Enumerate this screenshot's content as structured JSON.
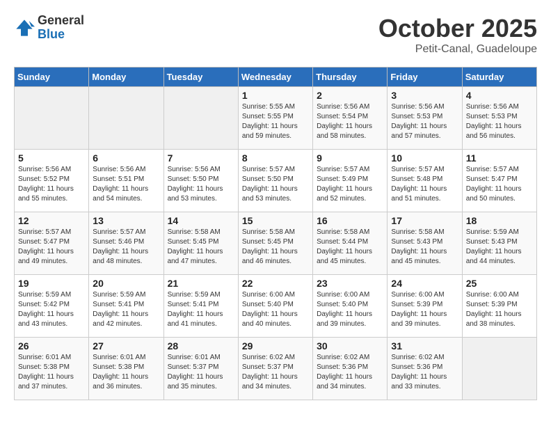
{
  "logo": {
    "general": "General",
    "blue": "Blue"
  },
  "header": {
    "month": "October 2025",
    "location": "Petit-Canal, Guadeloupe"
  },
  "weekdays": [
    "Sunday",
    "Monday",
    "Tuesday",
    "Wednesday",
    "Thursday",
    "Friday",
    "Saturday"
  ],
  "weeks": [
    [
      {
        "day": "",
        "info": ""
      },
      {
        "day": "",
        "info": ""
      },
      {
        "day": "",
        "info": ""
      },
      {
        "day": "1",
        "info": "Sunrise: 5:55 AM\nSunset: 5:55 PM\nDaylight: 11 hours\nand 59 minutes."
      },
      {
        "day": "2",
        "info": "Sunrise: 5:56 AM\nSunset: 5:54 PM\nDaylight: 11 hours\nand 58 minutes."
      },
      {
        "day": "3",
        "info": "Sunrise: 5:56 AM\nSunset: 5:53 PM\nDaylight: 11 hours\nand 57 minutes."
      },
      {
        "day": "4",
        "info": "Sunrise: 5:56 AM\nSunset: 5:53 PM\nDaylight: 11 hours\nand 56 minutes."
      }
    ],
    [
      {
        "day": "5",
        "info": "Sunrise: 5:56 AM\nSunset: 5:52 PM\nDaylight: 11 hours\nand 55 minutes."
      },
      {
        "day": "6",
        "info": "Sunrise: 5:56 AM\nSunset: 5:51 PM\nDaylight: 11 hours\nand 54 minutes."
      },
      {
        "day": "7",
        "info": "Sunrise: 5:56 AM\nSunset: 5:50 PM\nDaylight: 11 hours\nand 53 minutes."
      },
      {
        "day": "8",
        "info": "Sunrise: 5:57 AM\nSunset: 5:50 PM\nDaylight: 11 hours\nand 53 minutes."
      },
      {
        "day": "9",
        "info": "Sunrise: 5:57 AM\nSunset: 5:49 PM\nDaylight: 11 hours\nand 52 minutes."
      },
      {
        "day": "10",
        "info": "Sunrise: 5:57 AM\nSunset: 5:48 PM\nDaylight: 11 hours\nand 51 minutes."
      },
      {
        "day": "11",
        "info": "Sunrise: 5:57 AM\nSunset: 5:47 PM\nDaylight: 11 hours\nand 50 minutes."
      }
    ],
    [
      {
        "day": "12",
        "info": "Sunrise: 5:57 AM\nSunset: 5:47 PM\nDaylight: 11 hours\nand 49 minutes."
      },
      {
        "day": "13",
        "info": "Sunrise: 5:57 AM\nSunset: 5:46 PM\nDaylight: 11 hours\nand 48 minutes."
      },
      {
        "day": "14",
        "info": "Sunrise: 5:58 AM\nSunset: 5:45 PM\nDaylight: 11 hours\nand 47 minutes."
      },
      {
        "day": "15",
        "info": "Sunrise: 5:58 AM\nSunset: 5:45 PM\nDaylight: 11 hours\nand 46 minutes."
      },
      {
        "day": "16",
        "info": "Sunrise: 5:58 AM\nSunset: 5:44 PM\nDaylight: 11 hours\nand 45 minutes."
      },
      {
        "day": "17",
        "info": "Sunrise: 5:58 AM\nSunset: 5:43 PM\nDaylight: 11 hours\nand 45 minutes."
      },
      {
        "day": "18",
        "info": "Sunrise: 5:59 AM\nSunset: 5:43 PM\nDaylight: 11 hours\nand 44 minutes."
      }
    ],
    [
      {
        "day": "19",
        "info": "Sunrise: 5:59 AM\nSunset: 5:42 PM\nDaylight: 11 hours\nand 43 minutes."
      },
      {
        "day": "20",
        "info": "Sunrise: 5:59 AM\nSunset: 5:41 PM\nDaylight: 11 hours\nand 42 minutes."
      },
      {
        "day": "21",
        "info": "Sunrise: 5:59 AM\nSunset: 5:41 PM\nDaylight: 11 hours\nand 41 minutes."
      },
      {
        "day": "22",
        "info": "Sunrise: 6:00 AM\nSunset: 5:40 PM\nDaylight: 11 hours\nand 40 minutes."
      },
      {
        "day": "23",
        "info": "Sunrise: 6:00 AM\nSunset: 5:40 PM\nDaylight: 11 hours\nand 39 minutes."
      },
      {
        "day": "24",
        "info": "Sunrise: 6:00 AM\nSunset: 5:39 PM\nDaylight: 11 hours\nand 39 minutes."
      },
      {
        "day": "25",
        "info": "Sunrise: 6:00 AM\nSunset: 5:39 PM\nDaylight: 11 hours\nand 38 minutes."
      }
    ],
    [
      {
        "day": "26",
        "info": "Sunrise: 6:01 AM\nSunset: 5:38 PM\nDaylight: 11 hours\nand 37 minutes."
      },
      {
        "day": "27",
        "info": "Sunrise: 6:01 AM\nSunset: 5:38 PM\nDaylight: 11 hours\nand 36 minutes."
      },
      {
        "day": "28",
        "info": "Sunrise: 6:01 AM\nSunset: 5:37 PM\nDaylight: 11 hours\nand 35 minutes."
      },
      {
        "day": "29",
        "info": "Sunrise: 6:02 AM\nSunset: 5:37 PM\nDaylight: 11 hours\nand 34 minutes."
      },
      {
        "day": "30",
        "info": "Sunrise: 6:02 AM\nSunset: 5:36 PM\nDaylight: 11 hours\nand 34 minutes."
      },
      {
        "day": "31",
        "info": "Sunrise: 6:02 AM\nSunset: 5:36 PM\nDaylight: 11 hours\nand 33 minutes."
      },
      {
        "day": "",
        "info": ""
      }
    ]
  ]
}
